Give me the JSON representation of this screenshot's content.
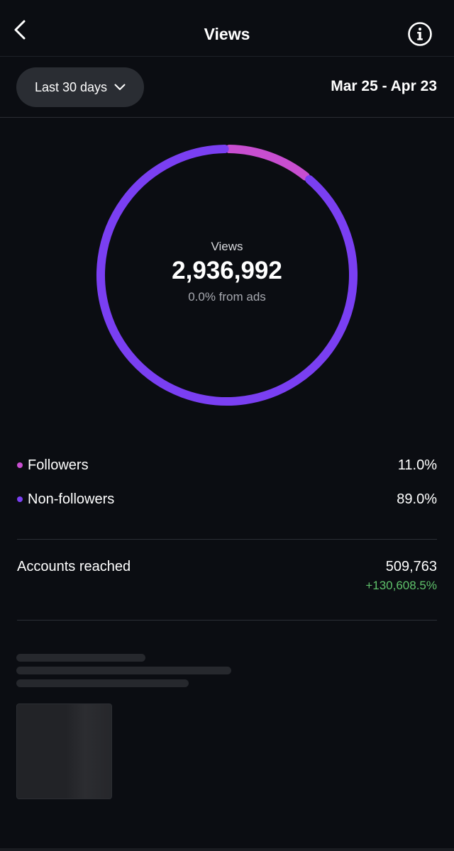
{
  "header": {
    "title": "Views",
    "back_icon": "chevron-left-icon",
    "info_icon": "info-icon"
  },
  "filter": {
    "range_label": "Last 30 days",
    "date_range": "Mar 25 - Apr 23"
  },
  "chart_data": {
    "type": "pie",
    "center_label": "Views",
    "total": "2,936,992",
    "subtext": "0.0% from ads",
    "slices": [
      {
        "name": "Followers",
        "value": 11.0,
        "color": "#c84ed0"
      },
      {
        "name": "Non-followers",
        "value": 89.0,
        "color": "#7a3ff2"
      }
    ]
  },
  "legend": [
    {
      "label": "Followers",
      "value": "11.0%",
      "color": "#c84ed0"
    },
    {
      "label": "Non-followers",
      "value": "89.0%",
      "color": "#7a3ff2"
    }
  ],
  "accounts_reached": {
    "label": "Accounts reached",
    "value": "509,763",
    "change": "+130,608.5%",
    "change_color": "#5fc26b"
  },
  "colors": {
    "background": "#0b0d12",
    "dropdown_bg": "#2a2d33",
    "skeleton": "#26282d"
  }
}
